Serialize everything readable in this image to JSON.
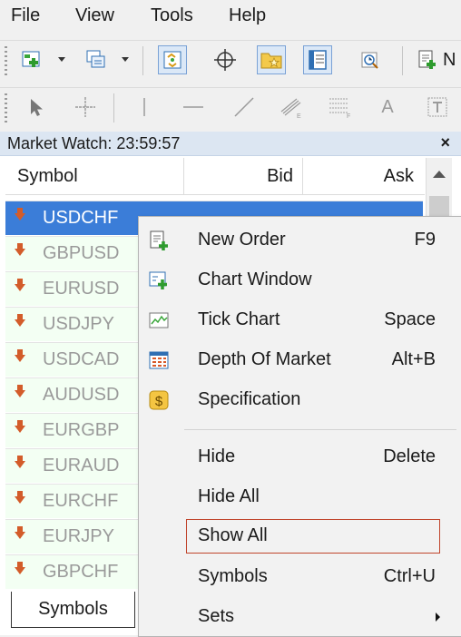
{
  "menubar": {
    "items": [
      "File",
      "View",
      "Tools",
      "Help"
    ]
  },
  "toolbar1": {
    "truncated_label": "N"
  },
  "toolbar2": {
    "text_tool": "A"
  },
  "market_watch": {
    "title": "Market Watch: 23:59:57",
    "close": "×",
    "columns": {
      "symbol": "Symbol",
      "bid": "Bid",
      "ask": "Ask"
    },
    "symbols": [
      "USDCHF",
      "GBPUSD",
      "EURUSD",
      "USDJPY",
      "USDCAD",
      "AUDUSD",
      "EURGBP",
      "EURAUD",
      "EURCHF",
      "EURJPY",
      "GBPCHF"
    ],
    "selected_index": 0,
    "tab": "Symbols"
  },
  "context_menu": {
    "items": [
      {
        "label": "New Order",
        "shortcut": "F9",
        "icon": "new-order-icon"
      },
      {
        "label": "Chart Window",
        "shortcut": "",
        "icon": "chart-window-icon"
      },
      {
        "label": "Tick Chart",
        "shortcut": "Space",
        "icon": "tick-chart-icon"
      },
      {
        "label": "Depth Of Market",
        "shortcut": "Alt+B",
        "icon": "depth-of-market-icon"
      },
      {
        "label": "Specification",
        "shortcut": "",
        "icon": "specification-icon"
      },
      {
        "label": "Hide",
        "shortcut": "Delete"
      },
      {
        "label": "Hide All",
        "shortcut": ""
      },
      {
        "label": "Show All",
        "shortcut": "",
        "highlighted": true
      },
      {
        "label": "Symbols",
        "shortcut": "Ctrl+U"
      },
      {
        "label": "Sets",
        "shortcut": "",
        "submenu": true
      }
    ]
  },
  "colors": {
    "selection": "#3b7dd8",
    "highlight_border": "#c0452c",
    "down_arrow": "#d35c2a"
  }
}
